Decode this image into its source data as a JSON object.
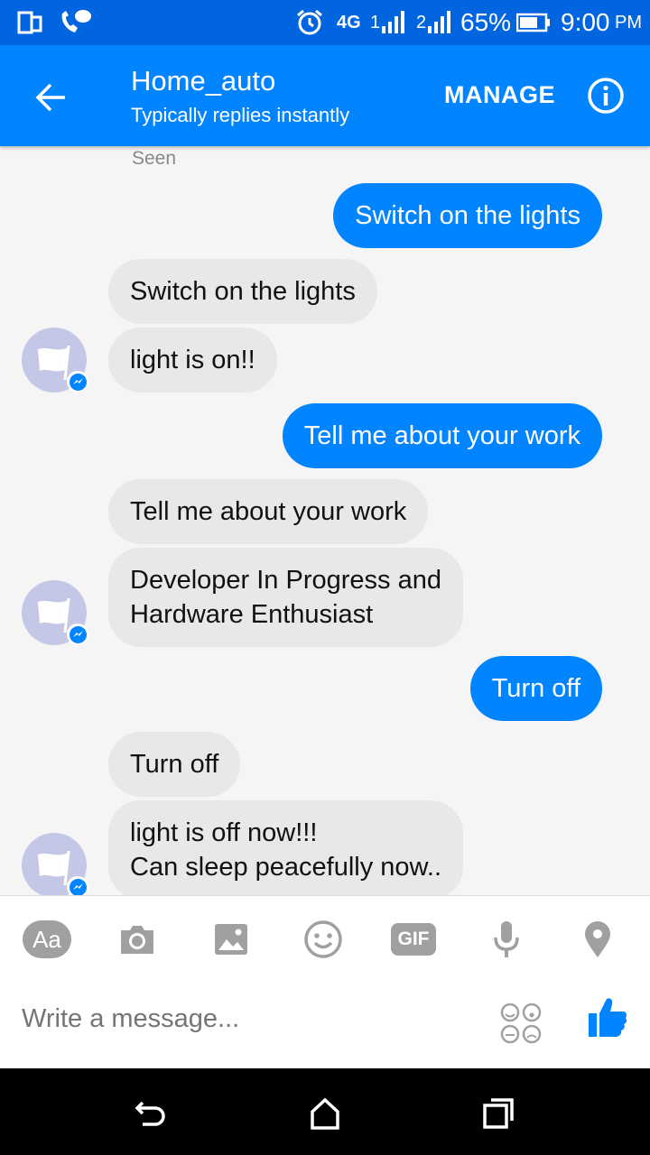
{
  "status_bar": {
    "network": "4G",
    "sim1": "1",
    "sim2": "2",
    "battery": "65%",
    "time": "9:00",
    "ampm": "PM"
  },
  "header": {
    "title": "Home_auto",
    "subtitle": "Typically replies instantly",
    "manage_label": "MANAGE"
  },
  "conversation": {
    "seen_label": "Seen",
    "messages": [
      {
        "from": "user",
        "text": "Switch on the lights"
      },
      {
        "from": "bot",
        "text": "Switch on the lights"
      },
      {
        "from": "bot",
        "text": "light is on!!"
      },
      {
        "from": "user",
        "text": "Tell me about your work"
      },
      {
        "from": "bot",
        "text": "Tell me about your work"
      },
      {
        "from": "bot",
        "text": "Developer In Progress and\nHardware Enthusiast"
      },
      {
        "from": "user",
        "text": "Turn off"
      },
      {
        "from": "bot",
        "text": "Turn off"
      },
      {
        "from": "bot",
        "text": "light is off now!!!\nCan sleep peacefully now.."
      }
    ]
  },
  "composer": {
    "text_style_label": "Aa",
    "gif_label": "GIF",
    "placeholder": "Write a message..."
  },
  "colors": {
    "status_bar": "#0265e0",
    "brand": "#0084ff",
    "incoming_bubble": "#e8e8e8"
  }
}
